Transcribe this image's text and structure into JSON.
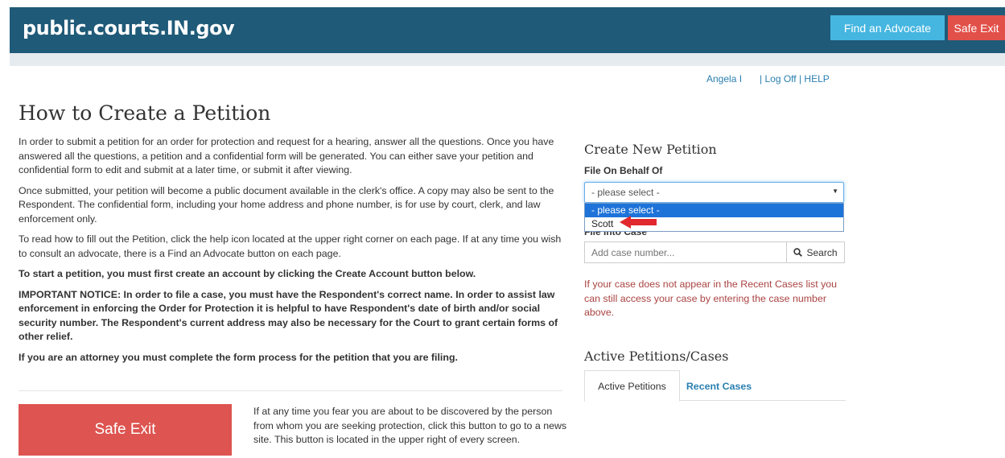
{
  "header": {
    "brand": "public.courts.IN.gov",
    "find_advocate": "Find an Advocate",
    "safe_exit": "Safe Exit"
  },
  "user": {
    "name": "Angela I",
    "separator1": "|",
    "log_off": "Log Off",
    "separator2": "|",
    "help": "HELP"
  },
  "main": {
    "title": "How to Create a Petition",
    "paragraphs": [
      "In order to submit a petition for an order for protection and request for a hearing, answer all the questions. Once you have answered all the questions, a petition and a confidential form will be generated. You can either save your petition and confidential form to edit and submit at a later time, or submit it after viewing.",
      "Once submitted, your petition will become a public document available in the clerk's office. A copy may also be sent to the Respondent. The confidential form, including your home address and phone number, is for use by court, clerk, and law enforcement only.",
      "To read how to fill out the Petition, click the help icon located at the upper right corner on each page. If at any time you wish to consult an advocate, there is a Find an Advocate button on each page.",
      "To start a petition, you must first create an account by clicking the Create Account button below.",
      "IMPORTANT NOTICE: In order to file a case, you must have the Respondent's correct name. In order to assist law enforcement in enforcing the Order for Protection it is helpful to have Respondent's date of birth and/or social security number. The Respondent's current address may also be necessary for the Court to grant certain forms of other relief.",
      "If you are an attorney you must complete the form process for the petition that you are filing."
    ],
    "safe_exit_button": "Safe Exit",
    "safe_exit_note": "If at any time you fear you are about to be discovered by the person from whom you are seeking protection, click this button to go to a news site. This button is located in the upper right of every screen."
  },
  "sidebar": {
    "create_heading": "Create New Petition",
    "behalf_label": "File On Behalf Of",
    "select_value": "- please select -",
    "options": [
      "- please select -",
      "Scott"
    ],
    "file_into_label": "File Into Case",
    "case_placeholder": "Add case number...",
    "search_label": "Search",
    "warning": "If your case does not appear in the Recent Cases list you can still access your case by entering the case number above.",
    "active_heading": "Active Petitions/Cases",
    "tabs": [
      "Active Petitions",
      "Recent Cases"
    ]
  },
  "colors": {
    "header_bg": "#1f5a78",
    "advocate_btn": "#45b6e0",
    "safe_exit_btn": "#e2504a",
    "link": "#2a7fb0",
    "warning": "#a94442",
    "arrow": "#e0282e"
  },
  "icons": {
    "search": "magnifier-icon",
    "caret": "caret-down-icon",
    "annotation": "red-arrow-icon"
  }
}
